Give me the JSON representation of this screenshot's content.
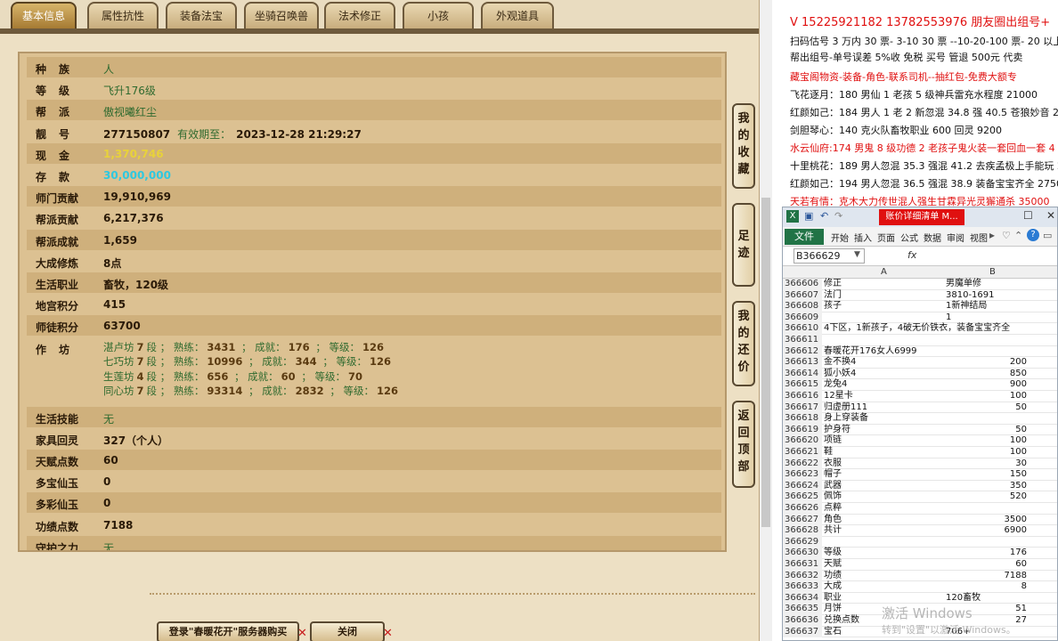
{
  "tabs": [
    "基本信息",
    "属性抗性",
    "装备法宝",
    "坐骑召唤兽",
    "法术修正",
    "小孩",
    "外观道具"
  ],
  "fields": [
    {
      "label": "种族",
      "value": "人",
      "style": "green"
    },
    {
      "label": "等级",
      "value": "飞升176级",
      "style": "green"
    },
    {
      "label": "帮派",
      "value": "傲视曦红尘",
      "style": "green"
    },
    {
      "label": "靓号",
      "value": "277150807",
      "sub": "有效期至：",
      "date": "2023-12-28 21:29:27",
      "style": "bold"
    },
    {
      "label": "现金",
      "value": "1,370,746",
      "style": "yellow"
    },
    {
      "label": "存款",
      "value": "30,000,000",
      "style": "cyan"
    },
    {
      "label": "师门贡献",
      "value": "19,910,969",
      "style": "bold"
    },
    {
      "label": "帮派贡献",
      "value": "6,217,376",
      "style": "bold"
    },
    {
      "label": "帮派成就",
      "value": "1,659",
      "style": "bold"
    },
    {
      "label": "大成修炼",
      "value": "8点",
      "style": "bold"
    },
    {
      "label": "生活职业",
      "value": "畜牧，120级",
      "style": "bold"
    },
    {
      "label": "地宫积分",
      "value": "415",
      "style": "bold"
    },
    {
      "label": "师徒积分",
      "value": "63700",
      "style": "bold"
    }
  ],
  "workshop": {
    "label": "作坊",
    "lines": [
      {
        "name": "湛卢坊",
        "dan": "7",
        "shu": "3431",
        "cheng": "176",
        "deng": "126"
      },
      {
        "name": "七巧坊",
        "dan": "7",
        "shu": "10996",
        "cheng": "344",
        "deng": "126"
      },
      {
        "name": "生莲坊",
        "dan": "4",
        "shu": "656",
        "cheng": "60",
        "deng": "70"
      },
      {
        "name": "同心坊",
        "dan": "7",
        "shu": "93314",
        "cheng": "2832",
        "deng": "126"
      }
    ],
    "dan_word": "段",
    "shu_word": "熟练：",
    "cheng_word": "成就：",
    "deng_word": "等级："
  },
  "fields2": [
    {
      "label": "生活技能",
      "value": "无",
      "style": "green"
    },
    {
      "label": "家具回灵",
      "value": "327（个人）",
      "style": "bold"
    },
    {
      "label": "天赋点数",
      "value": "60",
      "style": "bold"
    },
    {
      "label": "多宝仙玉",
      "value": "0",
      "style": "bold"
    },
    {
      "label": "多彩仙玉",
      "value": "0",
      "style": "bold"
    },
    {
      "label": "功绩点数",
      "value": "7188",
      "style": "bold"
    },
    {
      "label": "守护之力",
      "value": "无",
      "style": "green"
    }
  ],
  "side_buttons": [
    {
      "id": "my-collection",
      "text": "我的收藏"
    },
    {
      "id": "footprint",
      "text": "足迹"
    },
    {
      "id": "my-bargain",
      "text": "我的还价"
    },
    {
      "id": "back-top",
      "text": "返回顶部"
    }
  ],
  "footer": {
    "login_btn": "登录\"春暖花开\"服务器购买",
    "close_btn": "关闭"
  },
  "right_text": [
    {
      "text": "V 15225921182   13782553976 朋友圈出组号+",
      "style": "red big"
    },
    {
      "text": "扫码估号 3 万内 30 票- 3-10 30 票  --10-20-100 票- 20 以上 150",
      "style": ""
    },
    {
      "text": "帮出组号-单号误差 5%收 免税 买号 管退 500元 代卖",
      "style": ""
    },
    {
      "text": "藏宝阁物资-装备-角色-联系司机--抽红包-免费大额专",
      "style": "red"
    },
    {
      "text": "飞花逐月：180 男仙 1 老孩 5 级神兵雷充水程度 21000",
      "style": ""
    },
    {
      "text": "红颜如己：184 男人 1 老 2 新忽混 34.8 强 40.5 苍狼妙音 2290",
      "style": ""
    },
    {
      "text": "剑胆琴心：140 克火队畜牧职业 600 回灵 9200",
      "style": ""
    },
    {
      "text": "水云仙府:174 男鬼 8 级功德 2 老孩子鬼火装一套回血一套 4",
      "style": "red"
    },
    {
      "text": "十里桃花：189 男人忽混 35.3 强混 41.2 去疾孟极上手能玩 2",
      "style": ""
    },
    {
      "text": "红颜如己：194 男人忽混 36.5 强混 38.9 装备宝宝齐全 27500",
      "style": ""
    },
    {
      "text": "天若有情：克木大力传世混人强生甘霖异光灵獬通杀 35000",
      "style": "red"
    }
  ],
  "excel": {
    "title_tag": "账价详细清单 M...",
    "file_tab": "文件",
    "ribbon": [
      "开始",
      "插入",
      "页面",
      "公式",
      "数据",
      "审阅",
      "视图"
    ],
    "namebox": "B366629",
    "fx": "fx",
    "col_a": "A",
    "col_b": "B",
    "rows": [
      {
        "n": "366606",
        "a": "修正",
        "b": "男魔单修"
      },
      {
        "n": "366607",
        "a": "法门",
        "b": "3810-1691"
      },
      {
        "n": "366608",
        "a": "孩子",
        "b": "1新神结局"
      },
      {
        "n": "366609",
        "a": "",
        "b": "1"
      },
      {
        "n": "366610",
        "a": "4下区，1新孩子，4破无价铁衣，装备宝宝齐全",
        "b": ""
      },
      {
        "n": "366611",
        "a": "",
        "b": ""
      },
      {
        "n": "366612",
        "a": "春暖花开176女人6999",
        "b": ""
      },
      {
        "n": "366613",
        "a": "金不换4",
        "b": "200",
        "r": true
      },
      {
        "n": "366614",
        "a": "狐小妖4",
        "b": "850",
        "r": true
      },
      {
        "n": "366615",
        "a": "龙兔4",
        "b": "900",
        "r": true
      },
      {
        "n": "366616",
        "a": "12星卡",
        "b": "100",
        "r": true
      },
      {
        "n": "366617",
        "a": "归虚册111",
        "b": "50",
        "r": true
      },
      {
        "n": "366618",
        "a": "身上穿装备",
        "b": ""
      },
      {
        "n": "366619",
        "a": "护身符",
        "b": "50",
        "r": true
      },
      {
        "n": "366620",
        "a": "项链",
        "b": "100",
        "r": true
      },
      {
        "n": "366621",
        "a": "鞋",
        "b": "100",
        "r": true
      },
      {
        "n": "366622",
        "a": "衣服",
        "b": "30",
        "r": true
      },
      {
        "n": "366623",
        "a": "帽子",
        "b": "150",
        "r": true
      },
      {
        "n": "366624",
        "a": "武器",
        "b": "350",
        "r": true
      },
      {
        "n": "366625",
        "a": "佩饰",
        "b": "520",
        "r": true
      },
      {
        "n": "366626",
        "a": "点粹",
        "b": ""
      },
      {
        "n": "366627",
        "a": "角色",
        "b": "3500",
        "r": true
      },
      {
        "n": "366628",
        "a": "共计",
        "b": "6900",
        "r": true
      },
      {
        "n": "366629",
        "a": "",
        "b": ""
      },
      {
        "n": "366630",
        "a": "等级",
        "b": "176",
        "r": true
      },
      {
        "n": "366631",
        "a": "天赋",
        "b": "60",
        "r": true
      },
      {
        "n": "366632",
        "a": "功绩",
        "b": "7188",
        "r": true
      },
      {
        "n": "366633",
        "a": "大成",
        "b": "8",
        "r": true
      },
      {
        "n": "366634",
        "a": "职业",
        "b": "120畜牧"
      },
      {
        "n": "366635",
        "a": "月饼",
        "b": "51",
        "r": true
      },
      {
        "n": "366636",
        "a": "兑换点数",
        "b": "27",
        "r": true
      },
      {
        "n": "366637",
        "a": "宝石",
        "b": "706+"
      }
    ]
  },
  "watermark": {
    "line1": "激活 Windows",
    "line2": "转到\"设置\"以激活 Windows。"
  }
}
